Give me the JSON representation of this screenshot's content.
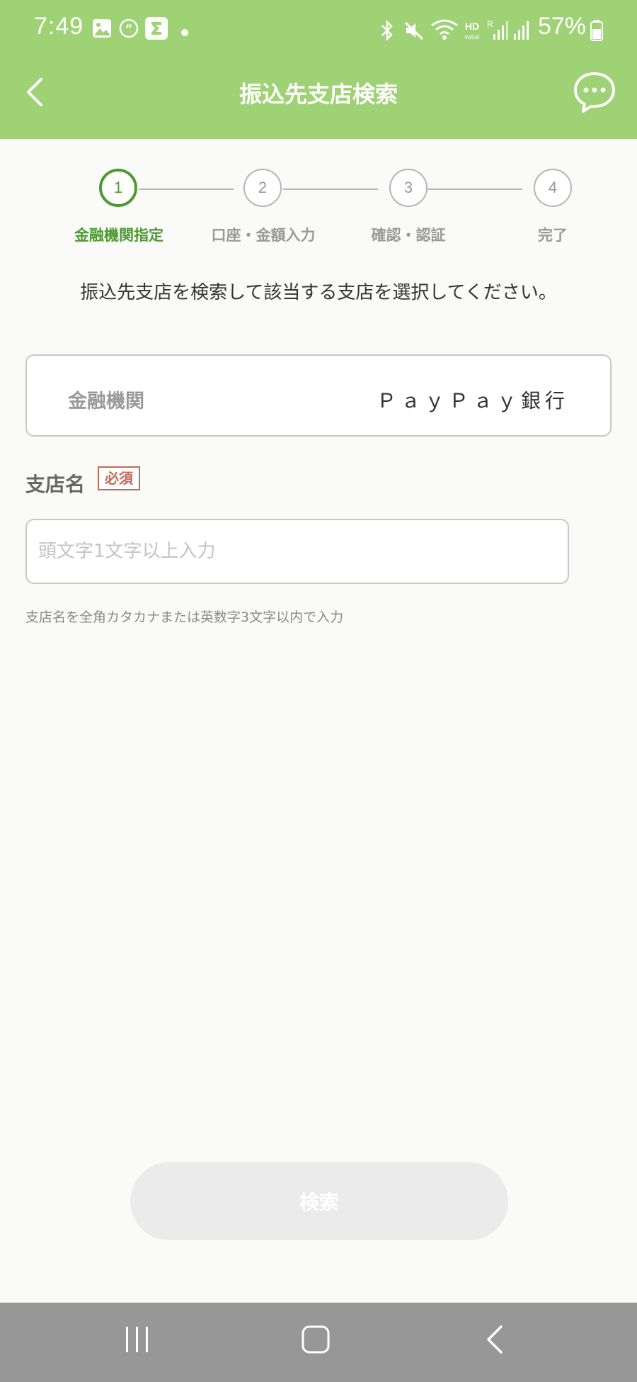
{
  "status_bar": {
    "time": "7:49",
    "battery": "57%",
    "icons": [
      "gallery-icon",
      "quote-icon",
      "sigma-app-icon",
      "dot-icon",
      "bluetooth-icon",
      "mute-icon",
      "wifi-icon",
      "hd-voice-icon",
      "signal-icon",
      "signal-icon",
      "battery-icon"
    ]
  },
  "header": {
    "title": "振込先支店検索",
    "back_icon": "chevron-left-icon",
    "chat_icon": "chat-bubble-icon"
  },
  "stepper": {
    "steps": [
      {
        "number": "1",
        "label": "金融機関指定",
        "active": true
      },
      {
        "number": "2",
        "label": "口座・金額入力",
        "active": false
      },
      {
        "number": "3",
        "label": "確認・認証",
        "active": false
      },
      {
        "number": "4",
        "label": "完了",
        "active": false
      }
    ]
  },
  "instruction": "振込先支店を検索して該当する支店を選択してください。",
  "bank": {
    "label": "金融機関",
    "value": "ＰａｙＰａｙ銀行"
  },
  "branch": {
    "label": "支店名",
    "required": "必須",
    "placeholder": "頭文字1文字以上入力",
    "value": "",
    "hint": "支店名を全角カタカナまたは英数字3文字以内で入力"
  },
  "search_button": {
    "label": "検索"
  },
  "colors": {
    "header_bg": "#9fd274",
    "accent": "#4e9a32",
    "required": "#c46a55",
    "nav_bar": "#979797"
  }
}
